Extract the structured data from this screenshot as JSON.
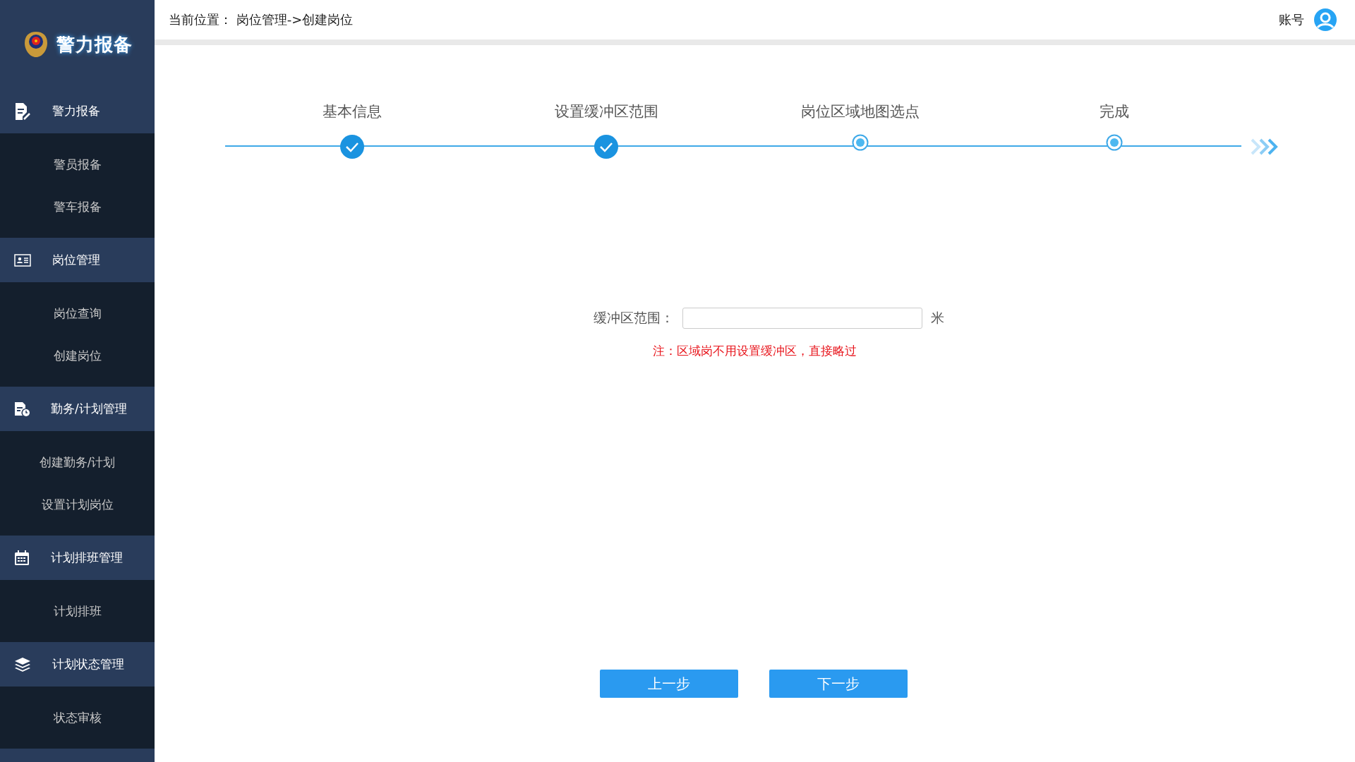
{
  "sidebar": {
    "logo_text": "警力报备",
    "groups": [
      {
        "kind": "report",
        "label": "警力报备",
        "children": [
          "警员报备",
          "警车报备"
        ]
      },
      {
        "kind": "idcard",
        "label": "岗位管理",
        "children": [
          "岗位查询",
          "创建岗位"
        ]
      },
      {
        "kind": "schedule",
        "label": "勤务/计划管理",
        "children": [
          "创建勤务/计划",
          "设置计划岗位"
        ]
      },
      {
        "kind": "calendar",
        "label": "计划排班管理",
        "children": [
          "计划排班"
        ]
      },
      {
        "kind": "layers",
        "label": "计划状态管理",
        "children": [
          "状态审核"
        ]
      }
    ]
  },
  "header": {
    "breadcrumb": "当前位置： 岗位管理->创建岗位",
    "account": "账号"
  },
  "steps": [
    {
      "label": "基本信息",
      "done": true
    },
    {
      "label": "设置缓冲区范围",
      "done": true
    },
    {
      "label": "岗位区域地图选点",
      "done": false
    },
    {
      "label": "完成",
      "done": false
    }
  ],
  "form": {
    "label": "缓冲区范围：",
    "unit": "米",
    "note": "注：区域岗不用设置缓冲区，直接略过"
  },
  "buttons": [
    "上一步",
    "下一步"
  ]
}
